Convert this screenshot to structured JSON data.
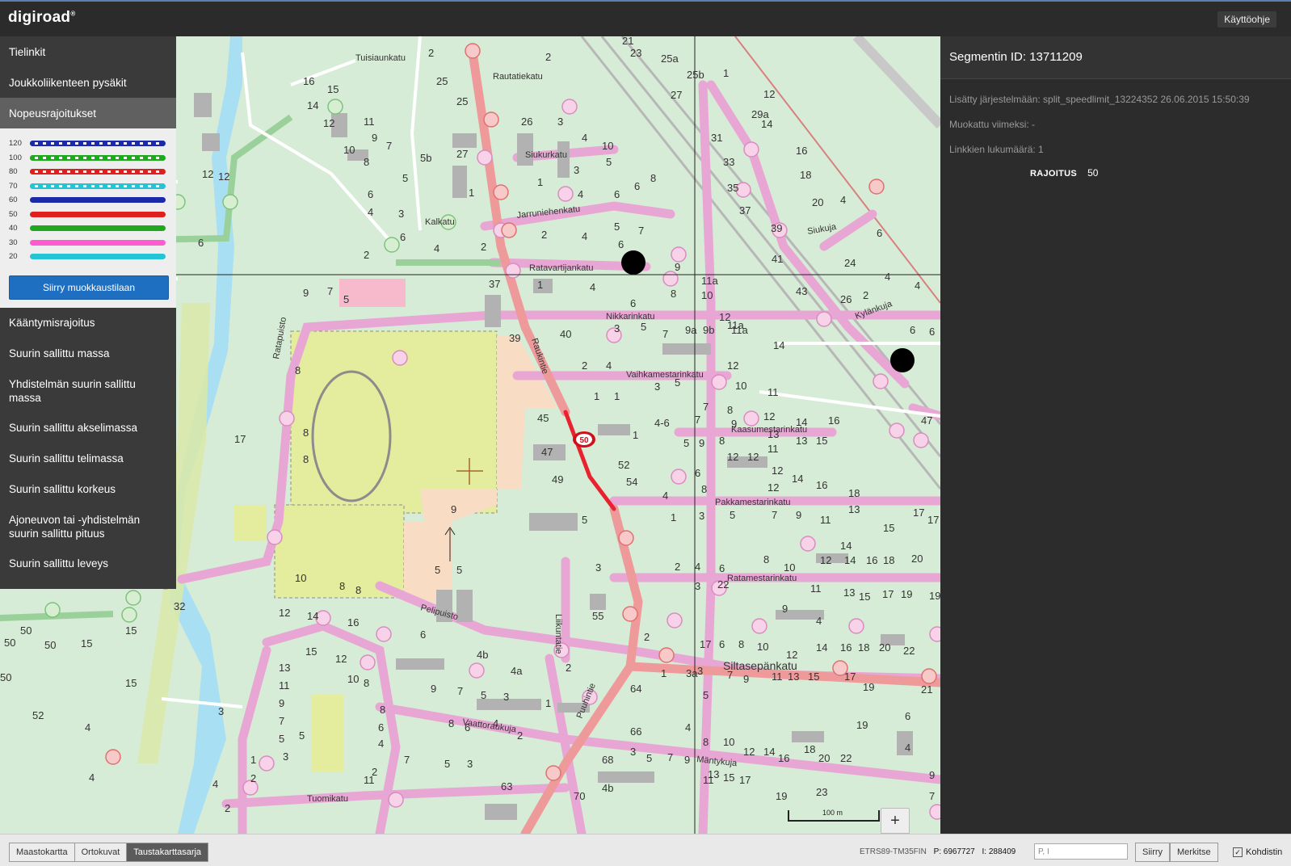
{
  "app": {
    "logo": "digiroad",
    "help_button": "Käyttöohje"
  },
  "sidebar": {
    "top_items": [
      "Tielinkit",
      "Joukkoliikenteen pysäkit",
      "Nopeusrajoitukset"
    ],
    "legend": [
      {
        "label": "120",
        "color": "#1b2aa8",
        "dashed": true
      },
      {
        "label": "100",
        "color": "#1fa81f",
        "dashed": true
      },
      {
        "label": "80",
        "color": "#e01f1f",
        "dashed": true
      },
      {
        "label": "70",
        "color": "#25c3d6",
        "dashed": true
      },
      {
        "label": "60",
        "color": "#1b2aa8",
        "dashed": false
      },
      {
        "label": "50",
        "color": "#e01f1f",
        "dashed": false
      },
      {
        "label": "40",
        "color": "#1fa81f",
        "dashed": false
      },
      {
        "label": "30",
        "color": "#ff5bd1",
        "dashed": false
      },
      {
        "label": "20",
        "color": "#25c3d6",
        "dashed": false
      }
    ],
    "edit_button": "Siirry muokkaustilaan",
    "bottom_items": [
      "Kääntymisrajoitus",
      "Suurin sallittu massa",
      "Yhdistelmän suurin sallittu massa",
      "Suurin sallittu akselimassa",
      "Suurin sallittu telimassa",
      "Suurin sallittu korkeus",
      "Ajoneuvon tai -yhdistelmän suurin sallittu pituus",
      "Suurin sallittu leveys"
    ]
  },
  "map": {
    "street_names": [
      "Rautatiekatu",
      "Siukurkatu",
      "Jarruniehenkatu",
      "Kalkatu",
      "Ratavartijankatu",
      "Nikkarinkatu",
      "Vaihkamestarinkatu",
      "Kaasumestarinkatu",
      "Pakkamestarinkatu",
      "Ratamestarinkatu",
      "Pelipuisto",
      "Siltasepänkatu",
      "Vaattoraukuja",
      "Mäntykuja",
      "Tuomikatu",
      "Ratapuisto",
      "Raukintie",
      "Puuhintie",
      "Kylänkuja",
      "Siukuja",
      "Liikuntatie",
      "Tuisiaunkatu"
    ],
    "selected_speed_badge": "50",
    "scale_label": "100 m",
    "zoom_in": "+",
    "zoom_out": "−"
  },
  "panel": {
    "title": "Segmentin ID: 13711209",
    "added": "Lisätty järjestelmään: split_speedlimit_13224352 26.06.2015 15:50:39",
    "modified": "Muokattu viimeksi: -",
    "link_count": "Linkkien lukumäärä: 1",
    "limit_label": "RAJOITUS",
    "limit_value": "50"
  },
  "bottombar": {
    "basemaps": [
      "Maastokartta",
      "Ortokuvat",
      "Taustakarttasarja"
    ],
    "selected_basemap": "Taustakarttasarja",
    "crs": "ETRS89-TM35FIN",
    "p_coord": "P: 6967727",
    "i_coord": "I: 288409",
    "search_placeholder": "P, I",
    "go_button": "Siirry",
    "mark_button": "Merkitse",
    "crosshair_checkbox": "Kohdistin"
  }
}
